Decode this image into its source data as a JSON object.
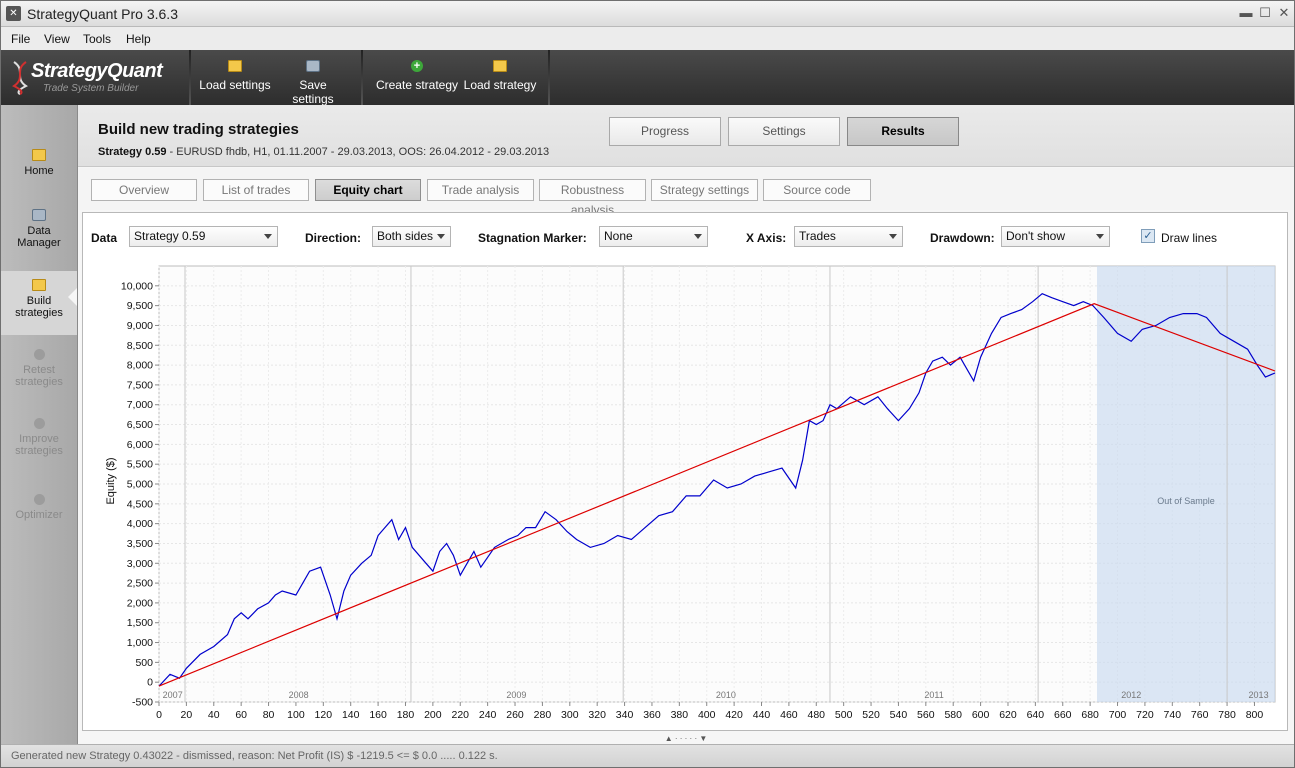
{
  "window": {
    "title": "StrategyQuant Pro  3.6.3"
  },
  "menu": [
    "File",
    "View",
    "Tools",
    "Help"
  ],
  "logo": {
    "name": "StrategyQuant",
    "tagline": "Trade System Builder"
  },
  "toolbar": {
    "load_settings": "Load settings",
    "save_settings": "Save settings",
    "create_strategy": "Create strategy",
    "load_strategy": "Load strategy"
  },
  "sidebar": {
    "items": [
      {
        "label": "Home",
        "lines": [
          "Home"
        ],
        "state": "enabled"
      },
      {
        "label": "Data Manager",
        "lines": [
          "Data",
          "Manager"
        ],
        "state": "enabled"
      },
      {
        "label": "Build strategies",
        "lines": [
          "Build",
          "strategies"
        ],
        "state": "active"
      },
      {
        "label": "Retest strategies",
        "lines": [
          "Retest",
          "strategies"
        ],
        "state": "disabled"
      },
      {
        "label": "Improve strategies",
        "lines": [
          "Improve",
          "strategies"
        ],
        "state": "disabled"
      },
      {
        "label": "Optimizer",
        "lines": [
          "Optimizer"
        ],
        "state": "disabled"
      }
    ]
  },
  "header": {
    "title": "Build new trading strategies",
    "strategy_name": "Strategy 0.59",
    "strategy_details": " - EURUSD  fhdb, H1, 01.11.2007 - 29.03.2013, OOS: 26.04.2012 - 29.03.2013",
    "tabs": [
      "Progress",
      "Settings",
      "Results"
    ],
    "active_tab": "Results"
  },
  "subtabs": {
    "items": [
      "Overview",
      "List of trades",
      "Equity chart",
      "Trade analysis",
      "Robustness analysis",
      "Strategy settings",
      "Source code"
    ],
    "active": "Equity chart"
  },
  "controls": {
    "data_label": "Data",
    "data_value": "Strategy 0.59",
    "direction_label": "Direction:",
    "direction_value": "Both sides",
    "stagnation_label": "Stagnation Marker:",
    "stagnation_value": "None",
    "xaxis_label": "X Axis:",
    "xaxis_value": "Trades",
    "drawdown_label": "Drawdown:",
    "drawdown_value": "Don't show",
    "draw_lines_label": "Draw lines",
    "draw_lines_checked": true
  },
  "chart_data": {
    "type": "line",
    "ylabel": "Equity ($)",
    "xlim": [
      0,
      815
    ],
    "ylim": [
      -500,
      10500
    ],
    "x_ticks": [
      0,
      20,
      40,
      60,
      80,
      100,
      120,
      140,
      160,
      180,
      200,
      220,
      240,
      260,
      280,
      300,
      320,
      340,
      360,
      380,
      400,
      420,
      440,
      460,
      480,
      500,
      520,
      540,
      560,
      580,
      600,
      620,
      640,
      660,
      680,
      700,
      720,
      740,
      760,
      780,
      800
    ],
    "y_ticks": [
      -500,
      0,
      500,
      1000,
      1500,
      2000,
      2500,
      3000,
      3500,
      4000,
      4500,
      5000,
      5500,
      6000,
      6500,
      7000,
      7500,
      8000,
      8500,
      9000,
      9500,
      10000
    ],
    "year_labels": [
      {
        "label": "2007",
        "x": 10
      },
      {
        "label": "2008",
        "x": 102
      },
      {
        "label": "2009",
        "x": 261
      },
      {
        "label": "2010",
        "x": 414
      },
      {
        "label": "2011",
        "x": 566
      },
      {
        "label": "2012",
        "x": 710
      },
      {
        "label": "2013",
        "x": 803
      }
    ],
    "year_dividers": [
      19,
      184,
      339,
      490,
      642,
      780
    ],
    "out_of_sample": {
      "label": "Out of Sample",
      "x_start": 685,
      "x_end": 815
    },
    "series": [
      {
        "color": "#0000cc",
        "points": [
          [
            0,
            -100
          ],
          [
            8,
            200
          ],
          [
            15,
            100
          ],
          [
            20,
            350
          ],
          [
            30,
            700
          ],
          [
            40,
            900
          ],
          [
            50,
            1200
          ],
          [
            55,
            1600
          ],
          [
            60,
            1750
          ],
          [
            65,
            1600
          ],
          [
            72,
            1850
          ],
          [
            80,
            2000
          ],
          [
            85,
            2200
          ],
          [
            90,
            2300
          ],
          [
            100,
            2200
          ],
          [
            105,
            2500
          ],
          [
            110,
            2800
          ],
          [
            118,
            2900
          ],
          [
            125,
            2200
          ],
          [
            130,
            1600
          ],
          [
            135,
            2300
          ],
          [
            140,
            2700
          ],
          [
            148,
            3000
          ],
          [
            155,
            3200
          ],
          [
            160,
            3700
          ],
          [
            165,
            3900
          ],
          [
            170,
            4100
          ],
          [
            175,
            3600
          ],
          [
            180,
            3900
          ],
          [
            185,
            3400
          ],
          [
            195,
            3000
          ],
          [
            200,
            2800
          ],
          [
            205,
            3300
          ],
          [
            210,
            3500
          ],
          [
            215,
            3200
          ],
          [
            220,
            2700
          ],
          [
            225,
            3000
          ],
          [
            230,
            3300
          ],
          [
            235,
            2900
          ],
          [
            245,
            3400
          ],
          [
            255,
            3600
          ],
          [
            262,
            3700
          ],
          [
            268,
            3900
          ],
          [
            275,
            3900
          ],
          [
            282,
            4300
          ],
          [
            290,
            4100
          ],
          [
            298,
            3800
          ],
          [
            305,
            3600
          ],
          [
            315,
            3400
          ],
          [
            325,
            3500
          ],
          [
            335,
            3700
          ],
          [
            345,
            3600
          ],
          [
            355,
            3900
          ],
          [
            365,
            4200
          ],
          [
            375,
            4300
          ],
          [
            385,
            4700
          ],
          [
            395,
            4700
          ],
          [
            405,
            5100
          ],
          [
            415,
            4900
          ],
          [
            425,
            5000
          ],
          [
            435,
            5200
          ],
          [
            445,
            5300
          ],
          [
            455,
            5400
          ],
          [
            465,
            4900
          ],
          [
            470,
            5600
          ],
          [
            475,
            6600
          ],
          [
            480,
            6500
          ],
          [
            485,
            6600
          ],
          [
            490,
            7000
          ],
          [
            495,
            6900
          ],
          [
            505,
            7200
          ],
          [
            515,
            7000
          ],
          [
            525,
            7200
          ],
          [
            532,
            6900
          ],
          [
            540,
            6600
          ],
          [
            548,
            6900
          ],
          [
            555,
            7300
          ],
          [
            560,
            7800
          ],
          [
            565,
            8100
          ],
          [
            572,
            8200
          ],
          [
            578,
            8000
          ],
          [
            585,
            8200
          ],
          [
            595,
            7600
          ],
          [
            600,
            8200
          ],
          [
            608,
            8800
          ],
          [
            615,
            9200
          ],
          [
            622,
            9300
          ],
          [
            630,
            9400
          ],
          [
            638,
            9600
          ],
          [
            645,
            9800
          ],
          [
            652,
            9700
          ],
          [
            660,
            9600
          ],
          [
            668,
            9500
          ],
          [
            675,
            9600
          ],
          [
            682,
            9500
          ],
          [
            690,
            9200
          ],
          [
            700,
            8800
          ],
          [
            710,
            8600
          ],
          [
            718,
            8900
          ],
          [
            728,
            9000
          ],
          [
            738,
            9200
          ],
          [
            748,
            9300
          ],
          [
            758,
            9300
          ],
          [
            765,
            9200
          ],
          [
            775,
            8800
          ],
          [
            785,
            8600
          ],
          [
            795,
            8400
          ],
          [
            802,
            8000
          ],
          [
            808,
            7700
          ],
          [
            815,
            7800
          ]
        ]
      },
      {
        "color": "#dd0000",
        "points": [
          [
            0,
            -100
          ],
          [
            683,
            9550
          ],
          [
            815,
            7850
          ]
        ]
      }
    ]
  },
  "status": {
    "text": "Generated new Strategy 0.43022 - dismissed, reason: Net Profit (IS)  $ -1219.5 <= $ 0.0  .....   0.122 s."
  }
}
